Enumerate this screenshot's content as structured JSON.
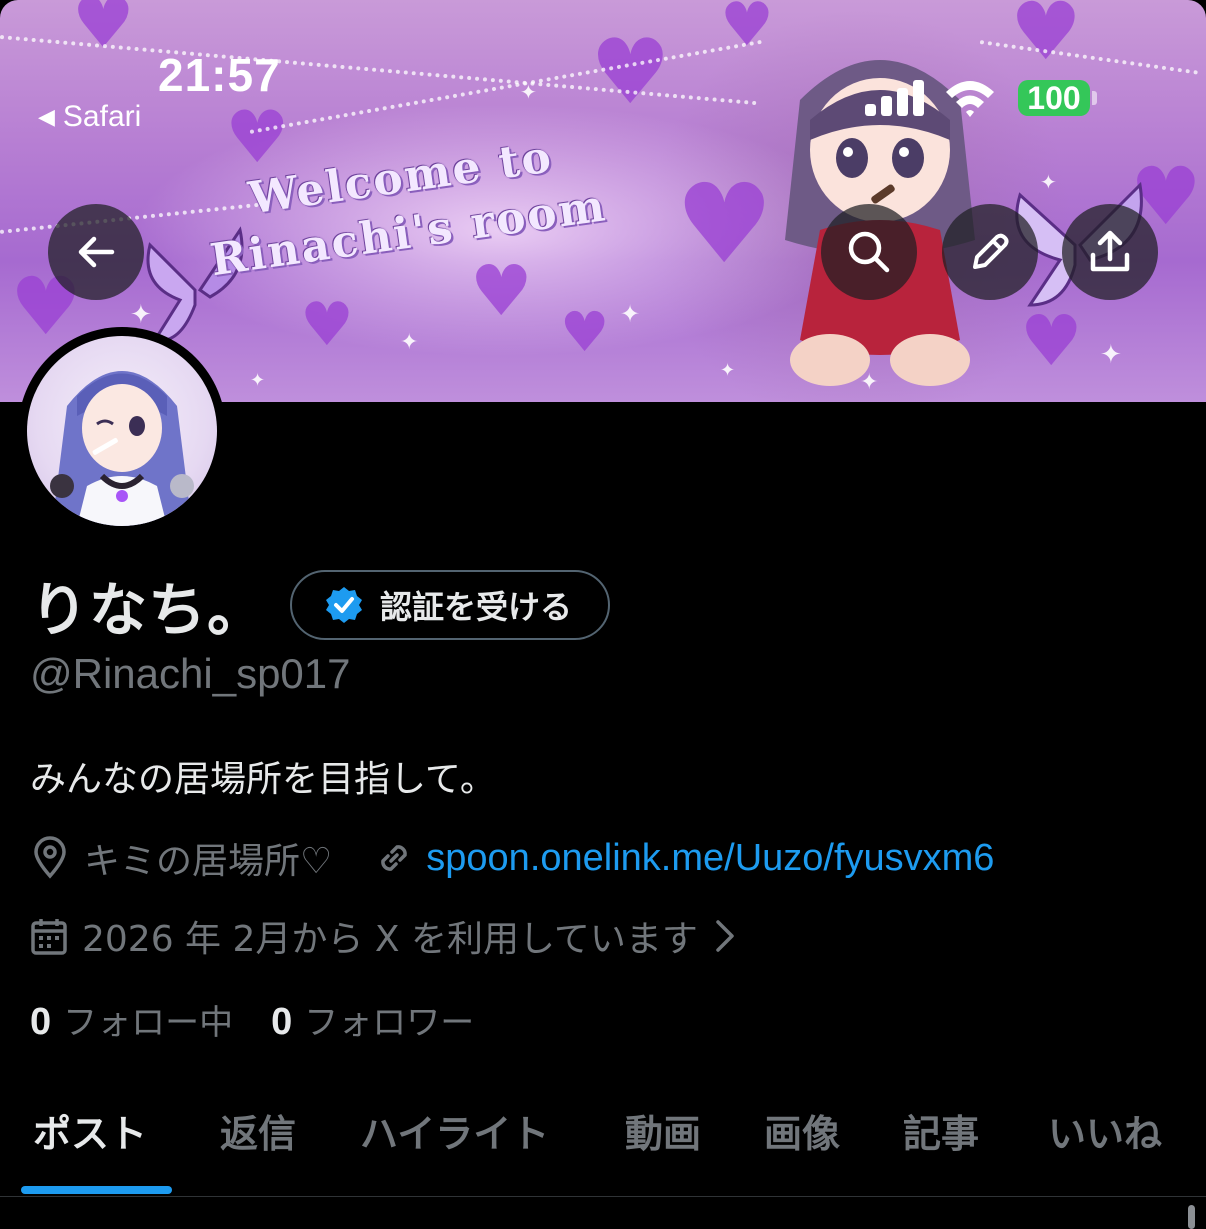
{
  "status_bar": {
    "time": "21:57",
    "back_app": "Safari",
    "battery": "100",
    "back_glyph": "◀"
  },
  "banner": {
    "text_line1": "Welcome to",
    "text_line2": "Rinachi's room"
  },
  "header_actions": {
    "back_icon": "arrow-left-icon",
    "search_icon": "search-icon",
    "edit_icon": "pencil-icon",
    "share_icon": "share-icon"
  },
  "profile": {
    "display_name": "りなち。",
    "verify_label": "認証を受ける",
    "handle": "@Rinachi_sp017",
    "bio": "みんなの居場所を目指して。",
    "location": "キミの居場所♡",
    "website": "spoon.onelink.me/Uuzo/fyusvxm6",
    "joined": "2026 年 2月から X を利用しています",
    "following_count": "0",
    "following_label": "フォロー中",
    "followers_count": "0",
    "followers_label": "フォロワー"
  },
  "tabs": [
    {
      "label": "ポスト",
      "active": true
    },
    {
      "label": "返信",
      "active": false
    },
    {
      "label": "ハイライト",
      "active": false
    },
    {
      "label": "動画",
      "active": false
    },
    {
      "label": "画像",
      "active": false
    },
    {
      "label": "記事",
      "active": false
    },
    {
      "label": "いいね",
      "active": false
    }
  ],
  "colors": {
    "accent": "#1d9bf0",
    "muted": "#71767b",
    "battery": "#34c759"
  }
}
